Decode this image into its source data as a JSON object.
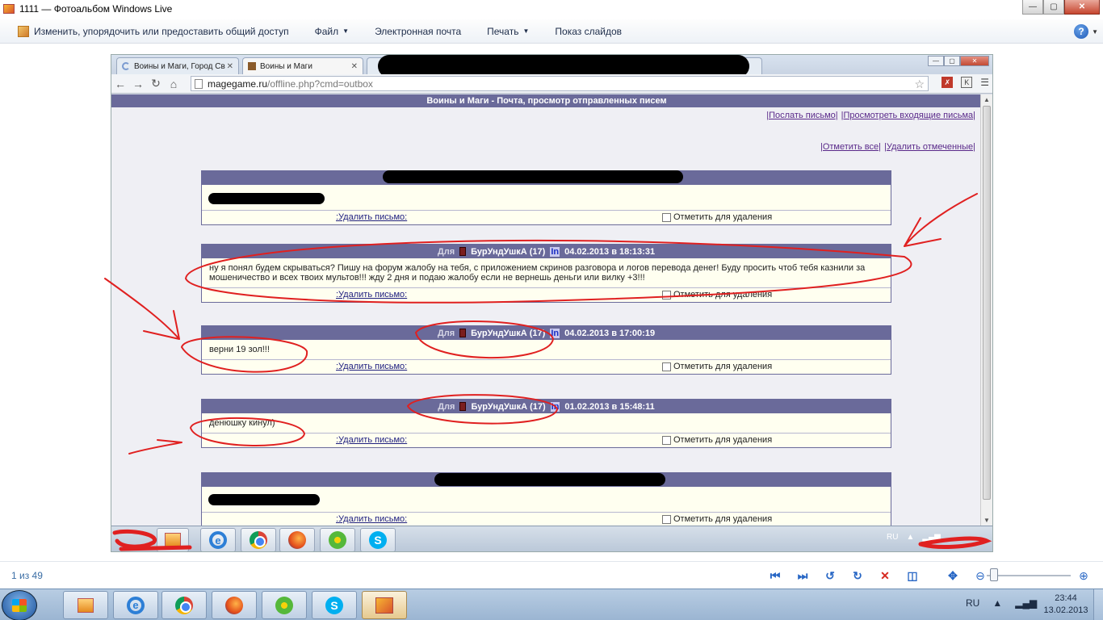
{
  "window": {
    "title": "1111 — Фотоальбом Windows Live"
  },
  "menu": {
    "organize": "Изменить, упорядочить или предоставить общий доступ",
    "file": "Файл",
    "email": "Электронная почта",
    "print": "Печать",
    "slideshow": "Показ слайдов"
  },
  "browser": {
    "tab1": "Воины и Маги, Город Св",
    "tab2": "Воины и Маги",
    "url_host": "magegame.ru",
    "url_path": "/offline.php?cmd=outbox"
  },
  "page": {
    "header": "Воины и Маги - Почта, просмотр отправленных писем",
    "send_link": "|Послать письмо|",
    "inbox_link": "|Просмотреть входящие письма|",
    "mark_all_link": "|Отметить все|",
    "delete_marked_link": "|Удалить отмеченные|",
    "delete_letter": ":Удалить письмо:",
    "mark_delete": "Отметить для удаления"
  },
  "messages": [
    {
      "to_label": "Для",
      "recipient": "БурУндУшкА (17)",
      "in": "In",
      "date": "04.02.2013 в 18:13:31",
      "text": "ну я понял будем скрываться? Пишу на форум жалобу на тебя, с приложением скринов разговора и логов перевода денег! Буду просить чтоб тебя казнили за мошеничество и всех твоих мультов!!! жду 2 дня и подаю жалобу если не вернешь деньги или вилку +3!!!"
    },
    {
      "to_label": "Для",
      "recipient": "БурУндУшкА (17)",
      "in": "In",
      "date": "04.02.2013 в 17:00:19",
      "text": "верни 19 зол!!!"
    },
    {
      "to_label": "Для",
      "recipient": "БурУндУшкА (17)",
      "in": "In",
      "date": "01.02.2013 в 15:48:11",
      "text": "денюшку кинул)"
    }
  ],
  "inner_tray": {
    "lang": "RU"
  },
  "status": {
    "counter": "1 из 49"
  },
  "taskbar": {
    "lang": "RU",
    "time": "23:44",
    "date": "13.02.2013"
  },
  "colors": {
    "forum_header": "#6a6a9a",
    "message_bg": "#fffff0",
    "annotation": "#e02020"
  }
}
